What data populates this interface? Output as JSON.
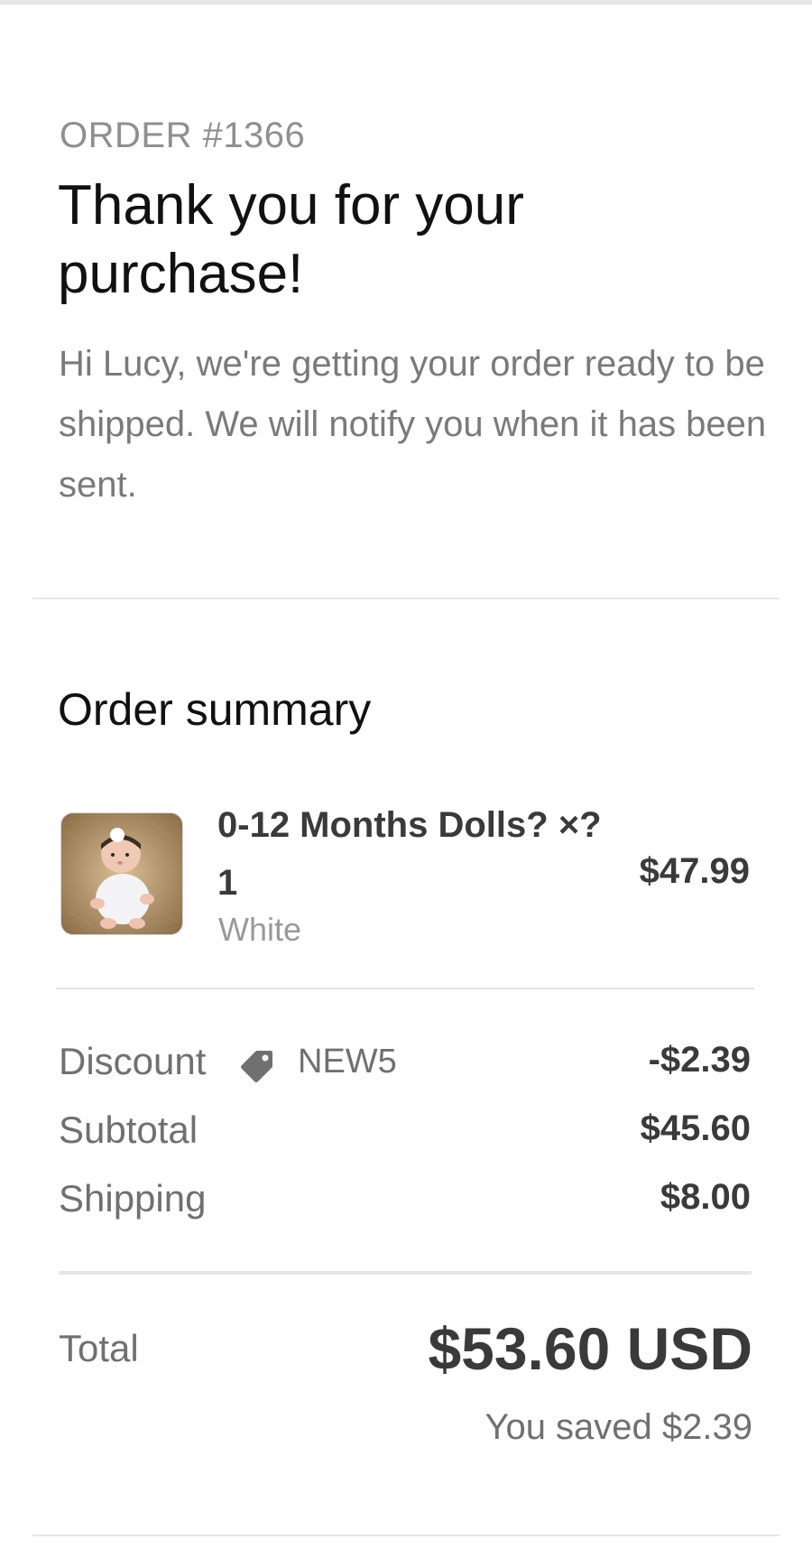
{
  "order": {
    "number_label": "ORDER #1366",
    "title": "Thank you for your purchase!",
    "greeting": "Hi Lucy, we're getting your order ready to be shipped. We will notify you when it has been sent."
  },
  "summary": {
    "heading": "Order summary",
    "items": [
      {
        "name": "0-12 Months Dolls? ×?1",
        "variant": "White",
        "price": "$47.99",
        "image_icon": "doll-product-photo"
      }
    ],
    "discount": {
      "label": "Discount",
      "icon": "tag-icon",
      "code": "NEW5",
      "value": "-$2.39"
    },
    "subtotal": {
      "label": "Subtotal",
      "value": "$45.60"
    },
    "shipping": {
      "label": "Shipping",
      "value": "$8.00"
    },
    "total": {
      "label": "Total",
      "value": "$53.60 USD"
    },
    "savings": "You saved $2.39"
  },
  "colors": {
    "primary_text": "#111111",
    "value_text": "#3a3a3a",
    "muted_text": "#707070",
    "divider": "#e6e6e6"
  }
}
